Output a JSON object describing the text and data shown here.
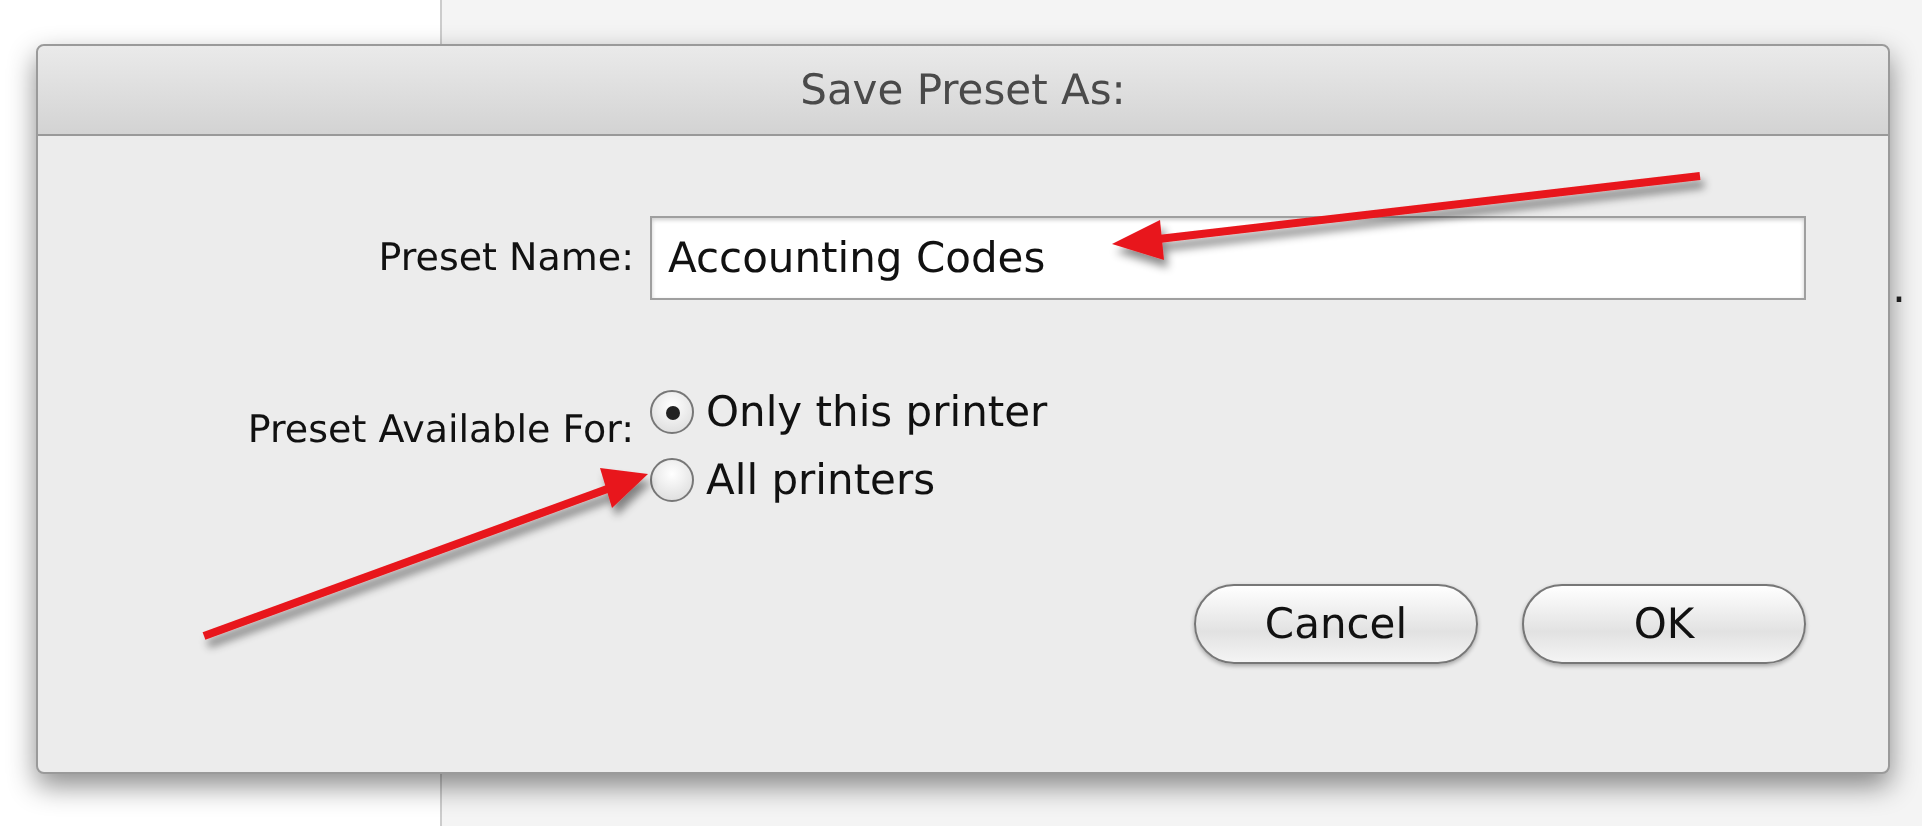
{
  "background": {
    "fragment": "."
  },
  "dialog": {
    "title": "Save Preset As:",
    "name_label": "Preset Name:",
    "name_value": "Accounting Codes",
    "availability_label": "Preset Available For:",
    "options": [
      {
        "label": "Only this printer",
        "selected": true
      },
      {
        "label": "All printers",
        "selected": false
      }
    ],
    "buttons": [
      "Cancel",
      "OK"
    ]
  }
}
